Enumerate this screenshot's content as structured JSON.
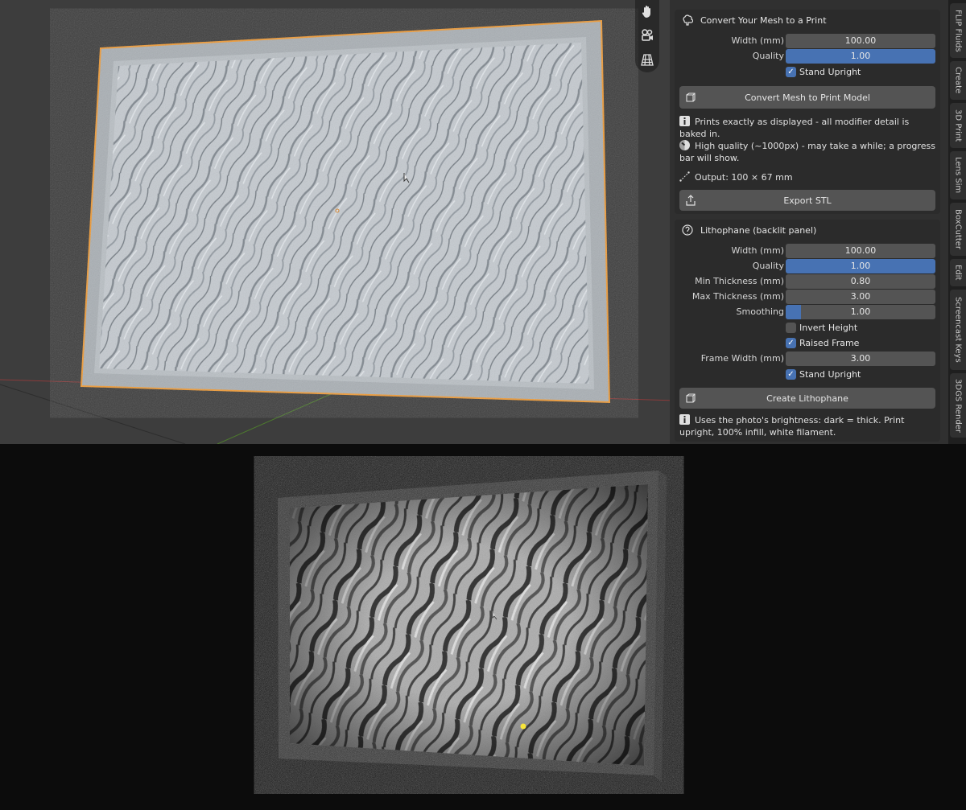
{
  "viewport": {
    "accent_colors": {
      "selection_outline": "#ef9a35",
      "panel_field": "#545454",
      "field_active": "#4772b3",
      "lithophane_glow": "#f7e53a"
    },
    "nav_icons": [
      "hand-pan-icon",
      "camera-icon",
      "grid-view-icon"
    ]
  },
  "print_panel": {
    "title": "Convert Your Mesh to a Print",
    "header_icon": "brain-icon",
    "fields": [
      {
        "label": "Width (mm)",
        "value": "100.00",
        "fill": 0
      },
      {
        "label": "Quality",
        "value": "1.00",
        "fill": 1
      }
    ],
    "stand_upright": {
      "label": "Stand Upright",
      "checked": true
    },
    "convert_button": "Convert Mesh to Print Model",
    "info_lines": [
      "Prints exactly as displayed - all modifier detail is baked in.",
      "High quality (~1000px) - may take a while; a progress bar will show."
    ],
    "output": "Output: 100 × 67 mm",
    "export_button": "Export STL"
  },
  "litho_panel": {
    "title": "Lithophane (backlit panel)",
    "header_icon": "lightbulb-icon",
    "fields": [
      {
        "label": "Width (mm)",
        "value": "100.00",
        "fill": 0
      },
      {
        "label": "Quality",
        "value": "1.00",
        "fill": 1
      },
      {
        "label": "Min Thickness (mm)",
        "value": "0.80",
        "fill": 0
      },
      {
        "label": "Max Thickness (mm)",
        "value": "3.00",
        "fill": 0
      },
      {
        "label": "Smoothing",
        "value": "1.00",
        "fill": 0.1
      }
    ],
    "invert_height": {
      "label": "Invert Height",
      "checked": false
    },
    "raised_frame": {
      "label": "Raised Frame",
      "checked": true
    },
    "frame_width": {
      "label": "Frame Width (mm)",
      "value": "3.00"
    },
    "stand_upright": {
      "label": "Stand Upright",
      "checked": true
    },
    "create_button": "Create Lithophane",
    "info": "Uses the photo's brightness: dark = thick. Print upright, 100% infill, white filament."
  },
  "tabs": [
    "FLIP Fluids",
    "Create",
    "3D Print",
    "Lens Sim",
    "BoxCutter",
    "Edit",
    "Screencast Keys",
    "3DGS Render"
  ]
}
